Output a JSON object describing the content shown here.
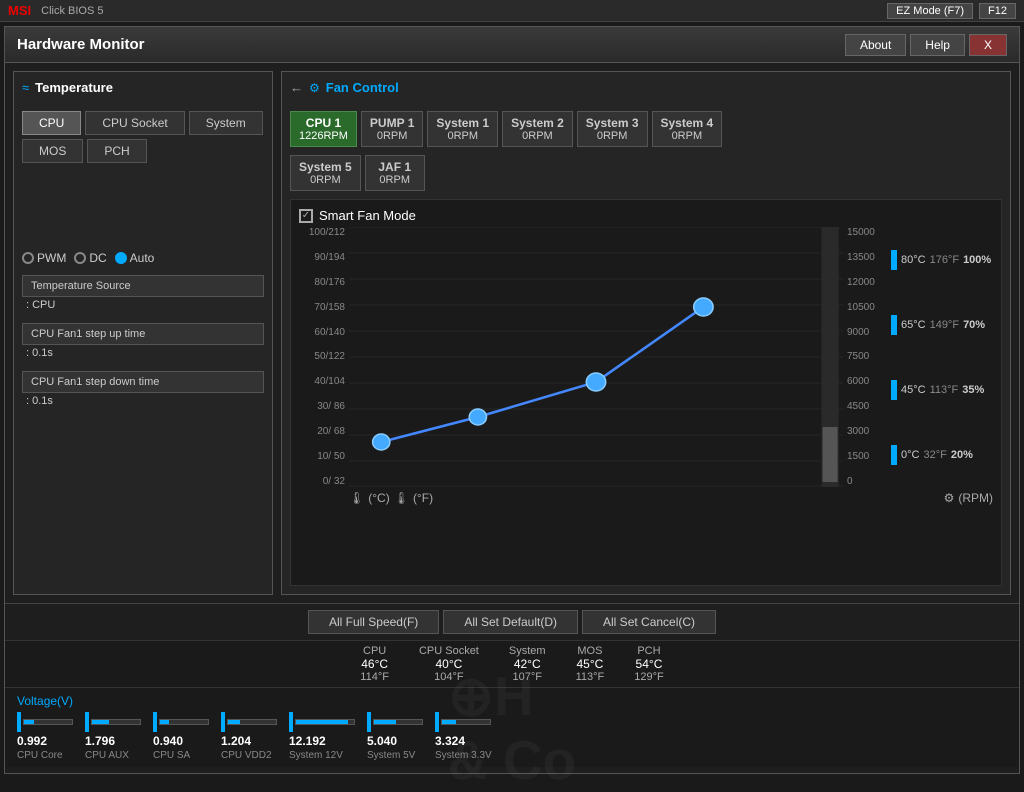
{
  "topbar": {
    "logo": "MSI",
    "ezmode_label": "EZ Mode (F7)"
  },
  "window": {
    "title": "Hardware Monitor",
    "about_label": "About",
    "help_label": "Help",
    "close_label": "X"
  },
  "temperature": {
    "section_title": "Temperature",
    "buttons": [
      "CPU",
      "CPU Socket",
      "System",
      "MOS",
      "PCH"
    ],
    "active_button": "CPU"
  },
  "fan_control": {
    "section_title": "Fan Control",
    "tabs": [
      {
        "name": "CPU 1",
        "rpm": "1226RPM",
        "active": true
      },
      {
        "name": "PUMP 1",
        "rpm": "0RPM",
        "active": false
      },
      {
        "name": "System 1",
        "rpm": "0RPM",
        "active": false
      },
      {
        "name": "System 2",
        "rpm": "0RPM",
        "active": false
      },
      {
        "name": "System 3",
        "rpm": "0RPM",
        "active": false
      },
      {
        "name": "System 4",
        "rpm": "0RPM",
        "active": false
      },
      {
        "name": "System 5",
        "rpm": "0RPM",
        "active": false
      },
      {
        "name": "JAF 1",
        "rpm": "0RPM",
        "active": false
      }
    ]
  },
  "smart_fan": {
    "title": "Smart Fan Mode",
    "checkbox": true,
    "y_labels": [
      "100/212",
      "90/194",
      "80/176",
      "70/158",
      "60/140",
      "50/122",
      "40/104",
      "30/ 86",
      "20/ 68",
      "10/ 50",
      "0/ 32"
    ],
    "rpm_labels": [
      "15000",
      "13500",
      "12000",
      "10500",
      "9000",
      "7500",
      "6000",
      "4500",
      "3000",
      "1500",
      "0"
    ],
    "right_labels": [
      {
        "temp_c": "80°C",
        "temp_f": "176°F",
        "pct": "100%"
      },
      {
        "temp_c": "65°C",
        "temp_f": "149°F",
        "pct": "70%"
      },
      {
        "temp_c": "45°C",
        "temp_f": "113°F",
        "pct": "35%"
      },
      {
        "temp_c": "0°C",
        "temp_f": "32°F",
        "pct": "20%"
      }
    ],
    "temp_icon": "🌡",
    "celsius_label": "(°C)",
    "fahrenheit_label": "(°F)",
    "fan_icon": "⚙",
    "rpm_label": "(RPM)"
  },
  "controls": {
    "modes": [
      "PWM",
      "DC",
      "Auto"
    ],
    "active_mode": "Auto",
    "temp_source_label": "Temperature Source",
    "temp_source_value": ": CPU",
    "step_up_label": "CPU Fan1 step up time",
    "step_up_value": ": 0.1s",
    "step_down_label": "CPU Fan1 step down time",
    "step_down_value": ": 0.1s"
  },
  "buttons": {
    "all_full_speed": "All Full Speed(F)",
    "all_set_default": "All Set Default(D)",
    "all_set_cancel": "All Set Cancel(C)"
  },
  "temperature_readings": [
    {
      "name": "CPU",
      "celsius": "46°C",
      "fahrenheit": "114°F"
    },
    {
      "name": "CPU Socket",
      "celsius": "40°C",
      "fahrenheit": "104°F"
    },
    {
      "name": "System",
      "celsius": "42°C",
      "fahrenheit": "107°F"
    },
    {
      "name": "MOS",
      "celsius": "45°C",
      "fahrenheit": "113°F"
    },
    {
      "name": "PCH",
      "celsius": "54°C",
      "fahrenheit": "129°F"
    }
  ],
  "voltage": {
    "title": "Voltage(V)",
    "items": [
      {
        "name": "CPU Core",
        "value": "0.992",
        "fill_pct": 20
      },
      {
        "name": "CPU AUX",
        "value": "1.796",
        "fill_pct": 36
      },
      {
        "name": "CPU SA",
        "value": "0.940",
        "fill_pct": 19
      },
      {
        "name": "CPU VDD2",
        "value": "1.204",
        "fill_pct": 24
      },
      {
        "name": "System 12V",
        "value": "12.192",
        "fill_pct": 90
      },
      {
        "name": "System 5V",
        "value": "5.040",
        "fill_pct": 45
      },
      {
        "name": "System 3.3V",
        "value": "3.324",
        "fill_pct": 30
      }
    ]
  }
}
